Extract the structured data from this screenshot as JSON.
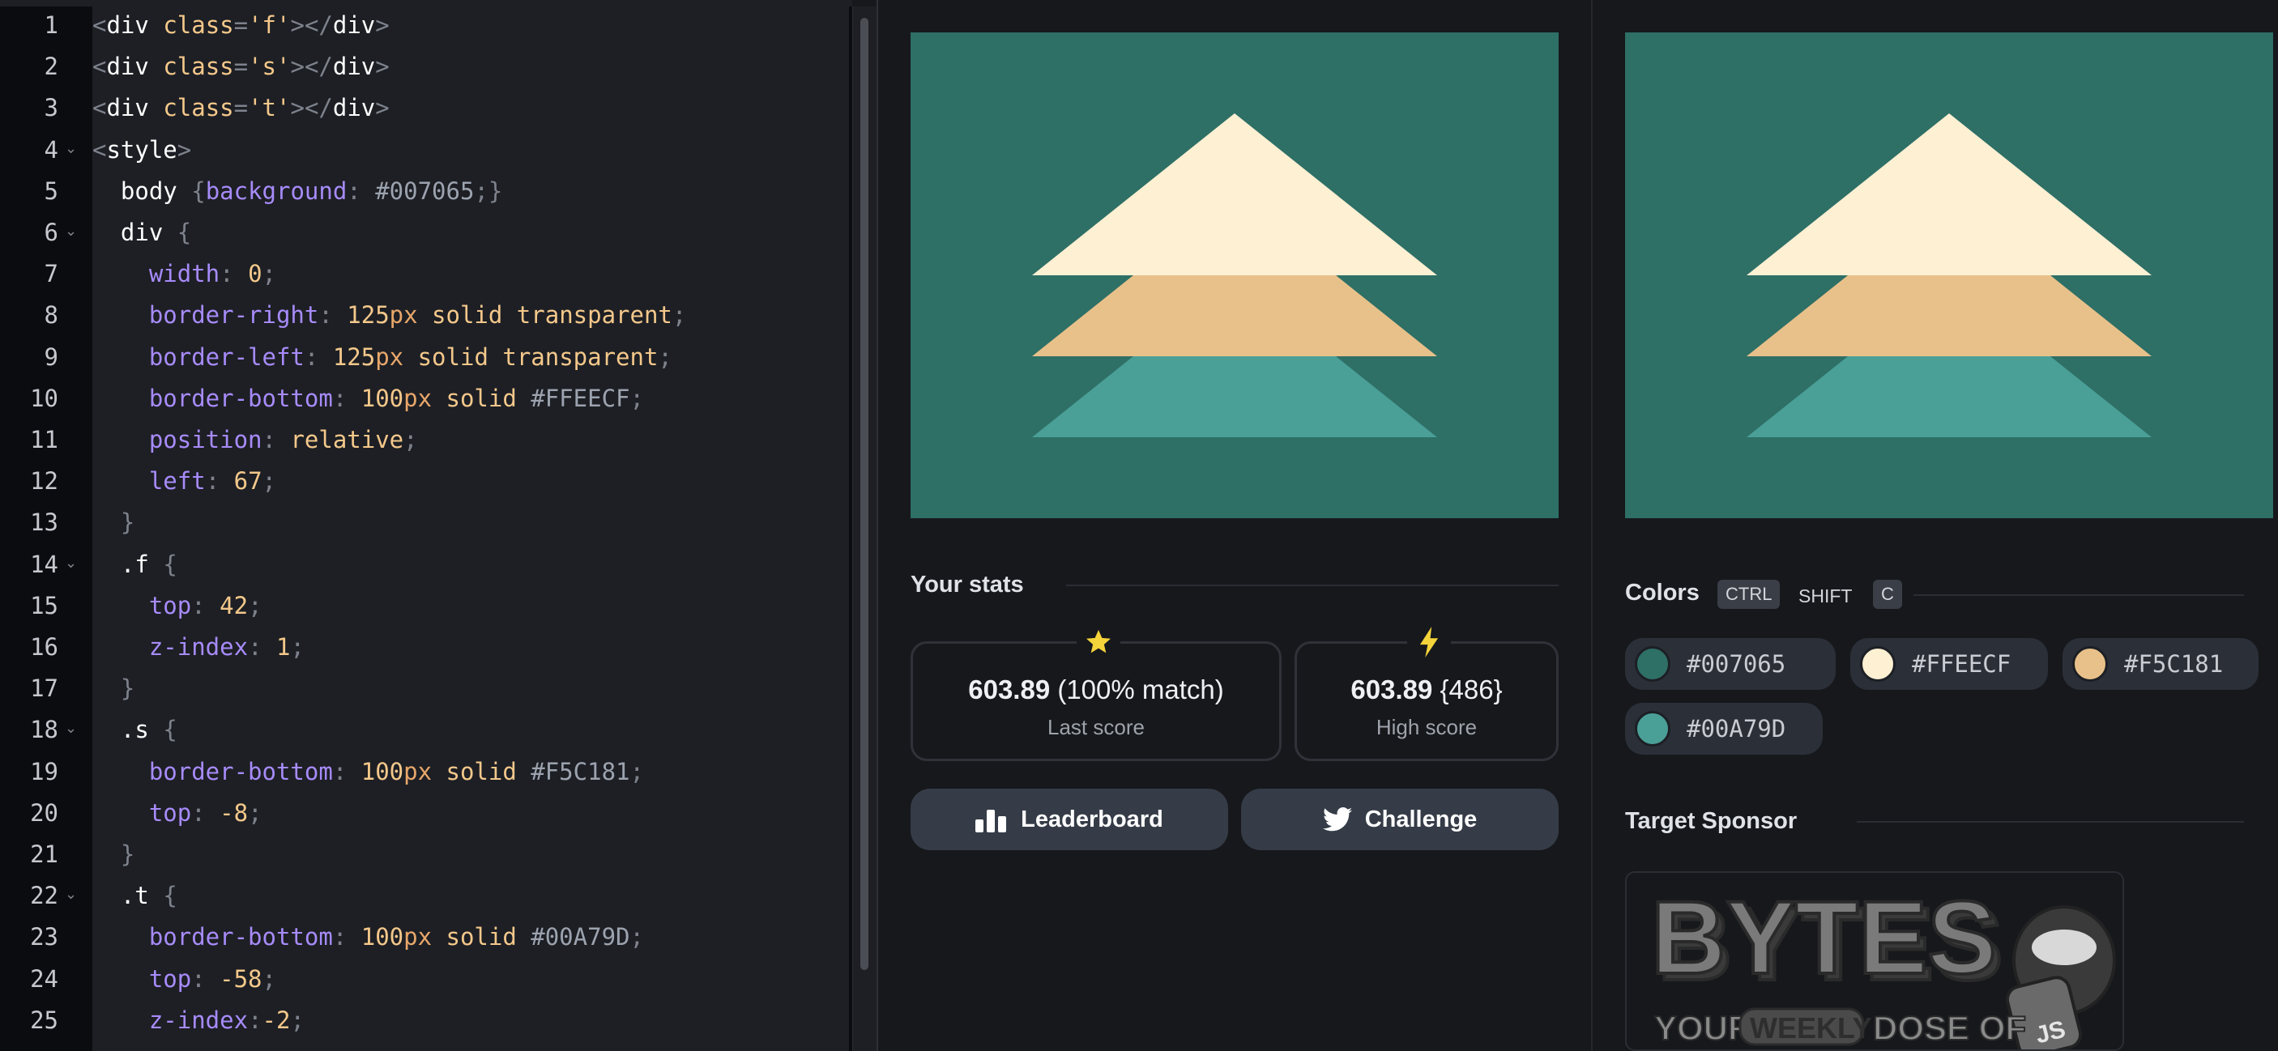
{
  "editor": {
    "lines": [
      {
        "n": "1",
        "fold": false,
        "tokens": [
          [
            "punc",
            "<"
          ],
          [
            "tag",
            "div "
          ],
          [
            "attr",
            "class"
          ],
          [
            "punc",
            "="
          ],
          [
            "str",
            "'f'"
          ],
          [
            "punc",
            "></"
          ],
          [
            "tag",
            "div"
          ],
          [
            "punc",
            ">"
          ]
        ]
      },
      {
        "n": "2",
        "fold": false,
        "tokens": [
          [
            "punc",
            "<"
          ],
          [
            "tag",
            "div "
          ],
          [
            "attr",
            "class"
          ],
          [
            "punc",
            "="
          ],
          [
            "str",
            "'s'"
          ],
          [
            "punc",
            "></"
          ],
          [
            "tag",
            "div"
          ],
          [
            "punc",
            ">"
          ]
        ]
      },
      {
        "n": "3",
        "fold": false,
        "tokens": [
          [
            "punc",
            "<"
          ],
          [
            "tag",
            "div "
          ],
          [
            "attr",
            "class"
          ],
          [
            "punc",
            "="
          ],
          [
            "str",
            "'t'"
          ],
          [
            "punc",
            "></"
          ],
          [
            "tag",
            "div"
          ],
          [
            "punc",
            ">"
          ]
        ]
      },
      {
        "n": "4",
        "fold": true,
        "tokens": [
          [
            "punc",
            "<"
          ],
          [
            "tag",
            "style"
          ],
          [
            "punc",
            ">"
          ]
        ]
      },
      {
        "n": "5",
        "fold": false,
        "tokens": [
          [
            "sel",
            "  body "
          ],
          [
            "punc",
            "{"
          ],
          [
            "prop",
            "background"
          ],
          [
            "punc",
            ": "
          ],
          [
            "hex",
            "#007065"
          ],
          [
            "punc",
            ";}"
          ]
        ]
      },
      {
        "n": "6",
        "fold": true,
        "tokens": [
          [
            "sel",
            "  div "
          ],
          [
            "punc",
            "{"
          ]
        ]
      },
      {
        "n": "7",
        "fold": false,
        "tokens": [
          [
            "prop",
            "    width"
          ],
          [
            "punc",
            ": "
          ],
          [
            "num",
            "0"
          ],
          [
            "punc",
            ";"
          ]
        ]
      },
      {
        "n": "8",
        "fold": false,
        "tokens": [
          [
            "prop",
            "    border-right"
          ],
          [
            "punc",
            ": "
          ],
          [
            "num",
            "125"
          ],
          [
            "unit",
            "px"
          ],
          [
            "val",
            " solid transparent"
          ],
          [
            "punc",
            ";"
          ]
        ]
      },
      {
        "n": "9",
        "fold": false,
        "tokens": [
          [
            "prop",
            "    border-left"
          ],
          [
            "punc",
            ": "
          ],
          [
            "num",
            "125"
          ],
          [
            "unit",
            "px"
          ],
          [
            "val",
            " solid transparent"
          ],
          [
            "punc",
            ";"
          ]
        ]
      },
      {
        "n": "10",
        "fold": false,
        "tokens": [
          [
            "prop",
            "    border-bottom"
          ],
          [
            "punc",
            ": "
          ],
          [
            "num",
            "100"
          ],
          [
            "unit",
            "px"
          ],
          [
            "val",
            " solid "
          ],
          [
            "hex",
            "#FFEECF"
          ],
          [
            "punc",
            ";"
          ]
        ]
      },
      {
        "n": "11",
        "fold": false,
        "tokens": [
          [
            "prop",
            "    position"
          ],
          [
            "punc",
            ": "
          ],
          [
            "val",
            "relative"
          ],
          [
            "punc",
            ";"
          ]
        ]
      },
      {
        "n": "12",
        "fold": false,
        "tokens": [
          [
            "prop",
            "    left"
          ],
          [
            "punc",
            ": "
          ],
          [
            "num",
            "67"
          ],
          [
            "punc",
            ";"
          ]
        ]
      },
      {
        "n": "13",
        "fold": false,
        "tokens": [
          [
            "punc",
            "  }"
          ]
        ]
      },
      {
        "n": "14",
        "fold": true,
        "tokens": [
          [
            "sel",
            "  .f "
          ],
          [
            "punc",
            "{"
          ]
        ]
      },
      {
        "n": "15",
        "fold": false,
        "tokens": [
          [
            "prop",
            "    top"
          ],
          [
            "punc",
            ": "
          ],
          [
            "num",
            "42"
          ],
          [
            "punc",
            ";"
          ]
        ]
      },
      {
        "n": "16",
        "fold": false,
        "tokens": [
          [
            "prop",
            "    z-index"
          ],
          [
            "punc",
            ": "
          ],
          [
            "num",
            "1"
          ],
          [
            "punc",
            ";"
          ]
        ]
      },
      {
        "n": "17",
        "fold": false,
        "tokens": [
          [
            "punc",
            "  }"
          ]
        ]
      },
      {
        "n": "18",
        "fold": true,
        "tokens": [
          [
            "sel",
            "  .s "
          ],
          [
            "punc",
            "{"
          ]
        ]
      },
      {
        "n": "19",
        "fold": false,
        "tokens": [
          [
            "prop",
            "    border-bottom"
          ],
          [
            "punc",
            ": "
          ],
          [
            "num",
            "100"
          ],
          [
            "unit",
            "px"
          ],
          [
            "val",
            " solid "
          ],
          [
            "hex",
            "#F5C181"
          ],
          [
            "punc",
            ";"
          ]
        ]
      },
      {
        "n": "20",
        "fold": false,
        "tokens": [
          [
            "prop",
            "    top"
          ],
          [
            "punc",
            ": "
          ],
          [
            "num",
            "-8"
          ],
          [
            "punc",
            ";"
          ]
        ]
      },
      {
        "n": "21",
        "fold": false,
        "tokens": [
          [
            "punc",
            "  }"
          ]
        ]
      },
      {
        "n": "22",
        "fold": true,
        "tokens": [
          [
            "sel",
            "  .t "
          ],
          [
            "punc",
            "{"
          ]
        ]
      },
      {
        "n": "23",
        "fold": false,
        "tokens": [
          [
            "prop",
            "    border-bottom"
          ],
          [
            "punc",
            ": "
          ],
          [
            "num",
            "100"
          ],
          [
            "unit",
            "px"
          ],
          [
            "val",
            " solid "
          ],
          [
            "hex",
            "#00A79D"
          ],
          [
            "punc",
            ";"
          ]
        ]
      },
      {
        "n": "24",
        "fold": false,
        "tokens": [
          [
            "prop",
            "    top"
          ],
          [
            "punc",
            ": "
          ],
          [
            "num",
            "-58"
          ],
          [
            "punc",
            ";"
          ]
        ]
      },
      {
        "n": "25",
        "fold": false,
        "tokens": [
          [
            "prop",
            "    z-index"
          ],
          [
            "punc",
            ":"
          ],
          [
            "num",
            "-2"
          ],
          [
            "punc",
            ";"
          ]
        ]
      }
    ]
  },
  "preview": {
    "background_color": "#2e6f66",
    "layer_colors": [
      "#fdf0d3",
      "#e8c18a",
      "#4a9f97"
    ]
  },
  "stats": {
    "title": "Your stats",
    "last_icon": "star-icon",
    "last_score": "603.89",
    "last_match": "(100% match)",
    "last_label": "Last score",
    "high_icon": "lightning-icon",
    "high_score": "603.89",
    "high_extra": "{486}",
    "high_label": "High score",
    "leaderboard_icon": "bar-chart-icon",
    "leaderboard_label": "Leaderboard",
    "challenge_icon": "twitter-icon",
    "challenge_label": "Challenge"
  },
  "colors": {
    "title": "Colors",
    "shortcut": [
      "CTRL",
      "SHIFT",
      "C"
    ],
    "items": [
      {
        "hex": "#007065",
        "swatch": "#2e6f66"
      },
      {
        "hex": "#FFEECF",
        "swatch": "#fdf0d3"
      },
      {
        "hex": "#F5C181",
        "swatch": "#e8c18a"
      },
      {
        "hex": "#00A79D",
        "swatch": "#4a9f97"
      }
    ]
  },
  "sponsor": {
    "title": "Target Sponsor",
    "logo_word": "BYTES",
    "tagline_1": "YOUR",
    "tagline_2": "WEEKLY",
    "tagline_3": "DOSE OF",
    "badge": "JS"
  }
}
